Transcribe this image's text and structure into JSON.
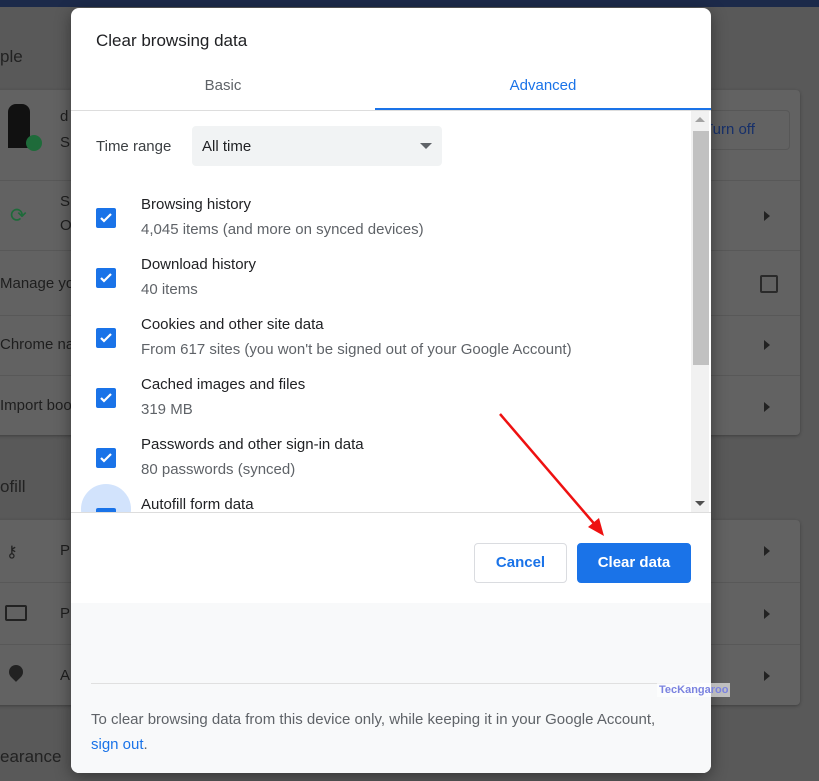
{
  "background": {
    "section1_heading": "ple",
    "profile_name": "d",
    "profile_sub": "S",
    "turn_off": "Turn off",
    "sync_title": "S",
    "sync_sub": "O",
    "manage": "Manage yo",
    "chrome_name": "Chrome na",
    "import": "Import boo",
    "section2_heading": "ofill",
    "passwords": "P",
    "payments": "P",
    "addresses": "A",
    "section3_heading": "earance"
  },
  "dialog": {
    "title": "Clear browsing data",
    "tabs": [
      {
        "label": "Basic"
      },
      {
        "label": "Advanced",
        "active": true
      }
    ],
    "time_range_label": "Time range",
    "time_range_value": "All time",
    "items": [
      {
        "title": "Browsing history",
        "sub": "4,045 items (and more on synced devices)",
        "checked": true
      },
      {
        "title": "Download history",
        "sub": "40 items",
        "checked": true
      },
      {
        "title": "Cookies and other site data",
        "sub": "From 617 sites (you won't be signed out of your Google Account)",
        "checked": true
      },
      {
        "title": "Cached images and files",
        "sub": "319 MB",
        "checked": true
      },
      {
        "title": "Passwords and other sign-in data",
        "sub": "80 passwords (synced)",
        "checked": true
      },
      {
        "title": "Autofill form data",
        "checked": true
      }
    ],
    "cancel_label": "Cancel",
    "clear_label": "Clear data",
    "footer_text": "To clear browsing data from this device only, while keeping it in your Google Account,",
    "footer_link": "sign out",
    "footer_end": "."
  },
  "watermark": "TecKangaroo",
  "colors": {
    "accent": "#1a73e8",
    "annotation": "#ee1111"
  }
}
